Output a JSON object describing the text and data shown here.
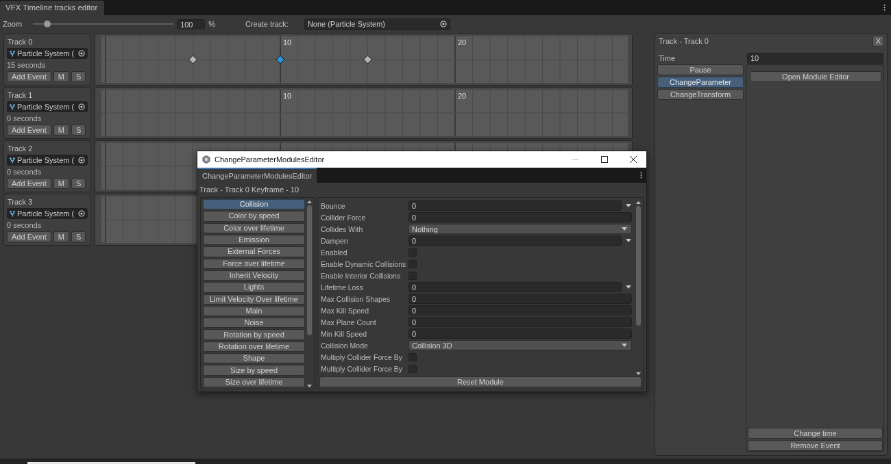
{
  "window": {
    "tab": "VFX Timeline tracks editor"
  },
  "toolbar": {
    "zoom_label": "Zoom",
    "zoom_slider": {
      "level": 0.1
    },
    "zoom_value": "100",
    "zoom_unit": "%",
    "create_track_label": "Create track:",
    "create_track_field": "None (Particle System)"
  },
  "tracks": [
    {
      "name": "Track 0",
      "object": "Particle System (",
      "duration": "15 seconds",
      "buttons": [
        "Add Event",
        "M",
        "S"
      ],
      "ruler_labels": [
        "10",
        "20"
      ],
      "keyframes": [
        {
          "level": 0.1667,
          "selected": false
        },
        {
          "level": 0.3333,
          "selected": true
        },
        {
          "level": 0.5,
          "selected": false
        }
      ]
    },
    {
      "name": "Track 1",
      "object": "Particle System (",
      "duration": "0 seconds",
      "buttons": [
        "Add Event",
        "M",
        "S"
      ],
      "ruler_labels": [
        "10",
        "20"
      ]
    },
    {
      "name": "Track 2",
      "object": "Particle System (",
      "duration": "0 seconds",
      "buttons": [
        "Add Event",
        "M",
        "S"
      ]
    },
    {
      "name": "Track 3",
      "object": "Particle System (",
      "duration": "0 seconds",
      "buttons": [
        "Add Event",
        "M",
        "S"
      ]
    }
  ],
  "inspector": {
    "title": "Track - Track 0",
    "close": "X",
    "time_label": "Time",
    "time_value": "10",
    "events": [
      {
        "label": "Pause",
        "selected": false
      },
      {
        "label": "ChangeParameter",
        "selected": true
      },
      {
        "label": "ChangeTransform",
        "selected": false
      }
    ],
    "open_button": "Open Module Editor",
    "actions": [
      "Change time",
      "Remove Event"
    ]
  },
  "dialog": {
    "title": "ChangeParameterModulesEditor",
    "tab": "ChangeParameterModulesEditor",
    "subtitle": "Track - Track 0 Keyframe - 10",
    "modules": [
      {
        "label": "Collision",
        "selected": true
      },
      {
        "label": "Color by speed",
        "selected": false
      },
      {
        "label": "Color over lifetime",
        "selected": false
      },
      {
        "label": "Emission",
        "selected": false
      },
      {
        "label": "External Forces",
        "selected": false
      },
      {
        "label": "Force over lifetime",
        "selected": false
      },
      {
        "label": "Inherit Velocity",
        "selected": false
      },
      {
        "label": "Lights",
        "selected": false
      },
      {
        "label": "Limit Velocity Over lifetime",
        "selected": false
      },
      {
        "label": "Main",
        "selected": false
      },
      {
        "label": "Noise",
        "selected": false
      },
      {
        "label": "Rotation by speed",
        "selected": false
      },
      {
        "label": "Rotation over lifetime",
        "selected": false
      },
      {
        "label": "Shape",
        "selected": false
      },
      {
        "label": "Size by speed",
        "selected": false
      },
      {
        "label": "Size over lifetime",
        "selected": false
      }
    ],
    "properties": [
      {
        "label": "Bounce",
        "kind": "curve",
        "value": "0"
      },
      {
        "label": "Collider Force",
        "kind": "number",
        "value": "0"
      },
      {
        "label": "Collides With",
        "kind": "dropdown",
        "value": "Nothing"
      },
      {
        "label": "Dampen",
        "kind": "curve",
        "value": "0"
      },
      {
        "label": "Enabled",
        "kind": "checkbox",
        "checked": false
      },
      {
        "label": "Enable Dynamic Collisions",
        "kind": "checkbox",
        "checked": false
      },
      {
        "label": "Enable Interior Collisions",
        "kind": "checkbox",
        "checked": false
      },
      {
        "label": "Lifetime Loss",
        "kind": "curve",
        "value": "0"
      },
      {
        "label": "Max Collision Shapes",
        "kind": "number",
        "value": "0"
      },
      {
        "label": "Max Kill Speed",
        "kind": "number",
        "value": "0"
      },
      {
        "label": "Max Plane Count",
        "kind": "number",
        "value": "0"
      },
      {
        "label": "Min Kill Speed",
        "kind": "number",
        "value": "0"
      },
      {
        "label": "Collision Mode",
        "kind": "dropdown",
        "value": "Collision 3D"
      },
      {
        "label": "Multiply Collider Force By",
        "kind": "checkbox",
        "checked": false
      },
      {
        "label": "Multiply Collider Force By",
        "kind": "checkbox",
        "checked": false
      }
    ],
    "reset_button": "Reset Module"
  }
}
